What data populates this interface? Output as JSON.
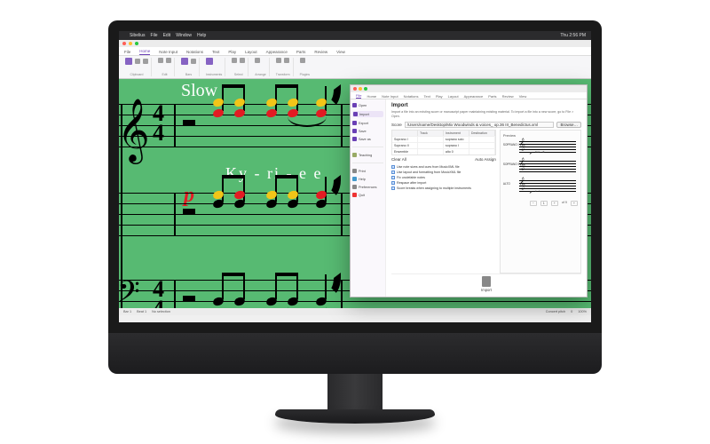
{
  "mac_menu": {
    "apple": "",
    "items": [
      "Sibelius",
      "File",
      "Edit",
      "Window",
      "Help"
    ],
    "right": "Thu 2:56 PM"
  },
  "app": {
    "ribbon_tabs": [
      "File",
      "Home",
      "Note Input",
      "Notations",
      "Text",
      "Play",
      "Layout",
      "Appearance",
      "Parts",
      "Review",
      "View"
    ],
    "ribbon_groups": [
      {
        "label": "Clipboard"
      },
      {
        "label": "Edit"
      },
      {
        "label": "Bars"
      },
      {
        "label": "Instruments"
      },
      {
        "label": "Select"
      },
      {
        "label": "Arrange"
      },
      {
        "label": "Transform"
      },
      {
        "label": "Plugins"
      }
    ],
    "status": {
      "left": [
        "Bar 1",
        "Beat 1",
        "No selection"
      ],
      "right": [
        "Concert pitch",
        "0",
        "100%"
      ]
    }
  },
  "score": {
    "tempo": "Slow",
    "time_sig": {
      "top": "4",
      "bottom": "4"
    },
    "lyrics": "Ky - ri - e  e",
    "dynamic": "p"
  },
  "dialog": {
    "tabs": [
      "File",
      "Home",
      "Note Input",
      "Notations",
      "Text",
      "Play",
      "Layout",
      "Appearance",
      "Parts",
      "Review",
      "View"
    ],
    "sidebar": {
      "upper": [
        "Open",
        "Import",
        "Export",
        "Save",
        "Save as"
      ],
      "lower": [
        "Teaching",
        "Print",
        "Help",
        "Preferences",
        "Quit"
      ]
    },
    "title": "Import",
    "desc": "Import a file into an existing score or manuscript paper maintaining existing material. To import a file into a new score, go to File > Open.",
    "file_label": "Score",
    "file_path": "/Users/name/Desktop/Mix Woodwinds & voices_ op.36 III_Benedictus.xml",
    "browse": "Browse…",
    "preview": "Preview",
    "table": {
      "headers": [
        "",
        "Track",
        "Instrument",
        "Destination"
      ],
      "rows": [
        [
          "Soprano I",
          "",
          "soprano solo",
          ""
        ],
        [
          "Soprano II",
          "",
          "soprano I",
          ""
        ],
        [
          "Ensemble",
          "",
          "alto 0",
          ""
        ]
      ]
    },
    "options": [
      "Use note sizes and cues from MusicXML file",
      "Use layout and formatting from MusicXML file",
      "Fix unclefable notes",
      "Respace after import",
      "Score breaks when assigning to multiple instruments"
    ],
    "auto_assign": "Auto Assign",
    "clear_all": "Clear All",
    "preview_voices": [
      "SOPRANO I",
      "SOPRANO II",
      "ALTO"
    ],
    "preview_dyn": "p",
    "preview_lyric": "Con - di",
    "preview_lyric2": "e - i",
    "foot_controls": [
      "−",
      "1",
      "+",
      "of 9",
      "+"
    ],
    "import_btn": "Import"
  }
}
